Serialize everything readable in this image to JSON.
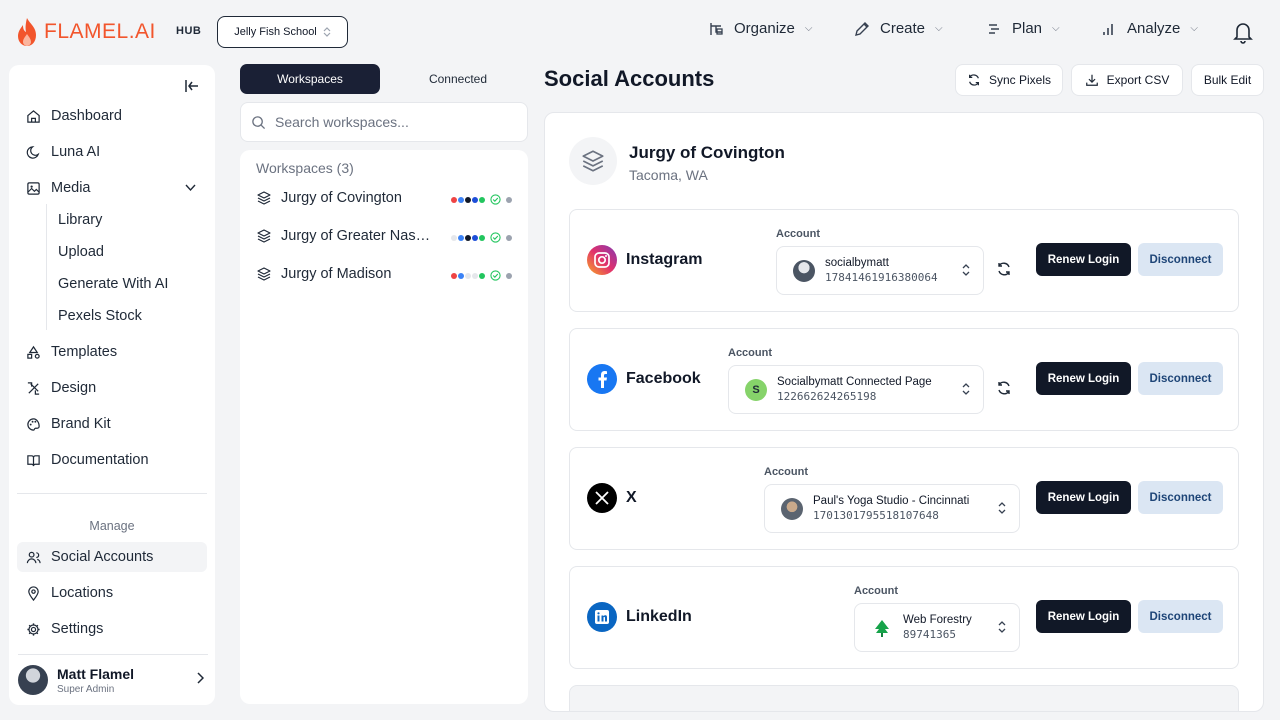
{
  "brand": {
    "logo_text": "FLAMEL.AI",
    "hub_label": "HUB",
    "accent": "#f2552c"
  },
  "header": {
    "school_selector": "Jelly Fish School",
    "nav": [
      {
        "label": "Organize",
        "icon": "organize-icon"
      },
      {
        "label": "Create",
        "icon": "pencil-icon"
      },
      {
        "label": "Plan",
        "icon": "list-icon"
      },
      {
        "label": "Analyze",
        "icon": "bar-chart-icon"
      }
    ]
  },
  "sidebar": {
    "items": [
      {
        "label": "Dashboard",
        "icon": "home-icon"
      },
      {
        "label": "Luna AI",
        "icon": "moon-icon"
      },
      {
        "label": "Media",
        "icon": "image-icon"
      },
      {
        "label": "Templates",
        "icon": "shapes-icon"
      },
      {
        "label": "Design",
        "icon": "design-icon"
      },
      {
        "label": "Brand Kit",
        "icon": "palette-icon"
      },
      {
        "label": "Documentation",
        "icon": "book-icon"
      }
    ],
    "media_sub": [
      "Library",
      "Upload",
      "Generate With AI",
      "Pexels Stock"
    ],
    "manage_label": "Manage",
    "manage_items": [
      {
        "label": "Social Accounts",
        "icon": "users-icon"
      },
      {
        "label": "Locations",
        "icon": "pin-icon"
      },
      {
        "label": "Settings",
        "icon": "gear-icon"
      }
    ],
    "user": {
      "name": "Matt Flamel",
      "role": "Super Admin"
    }
  },
  "workspaces": {
    "tabs": [
      "Workspaces",
      "Connected"
    ],
    "search_placeholder": "Search workspaces...",
    "heading": "Workspaces (3)",
    "items": [
      {
        "name": "Jurgy of Covington",
        "dots": [
          "#ef4444",
          "#3b82f6",
          "#111827",
          "#1d4ed8",
          "#22c55e"
        ]
      },
      {
        "name": "Jurgy of Greater Nashville",
        "dots": [
          "#e5e7eb",
          "#3b82f6",
          "#111827",
          "#1d4ed8",
          "#22c55e"
        ]
      },
      {
        "name": "Jurgy of Madison",
        "dots": [
          "#ef4444",
          "#3b82f6",
          "#e5e7eb",
          "#e5e7eb",
          "#22c55e"
        ]
      }
    ]
  },
  "page": {
    "title": "Social Accounts",
    "actions": [
      "Sync Pixels",
      "Export CSV",
      "Bulk Edit"
    ]
  },
  "location": {
    "name": "Jurgy of Covington",
    "city": "Tacoma, WA"
  },
  "accounts": [
    {
      "platform": "Instagram",
      "account_label": "Account",
      "account_name": "socialbymatt",
      "account_id": "17841461916380064",
      "renew_label": "Renew Login",
      "disconnect_label": "Disconnect"
    },
    {
      "platform": "Facebook",
      "account_label": "Account",
      "account_name": "Socialbymatt Connected Page",
      "account_id": "122662624265198",
      "avatar_letter": "S",
      "renew_label": "Renew Login",
      "disconnect_label": "Disconnect"
    },
    {
      "platform": "X",
      "account_label": "Account",
      "account_name": "Paul's Yoga Studio - Cincinnati",
      "account_id": "1701301795518107648",
      "renew_label": "Renew Login",
      "disconnect_label": "Disconnect"
    },
    {
      "platform": "LinkedIn",
      "account_label": "Account",
      "account_name": "Web Forestry",
      "account_id": "89741365",
      "renew_label": "Renew Login",
      "disconnect_label": "Disconnect"
    }
  ]
}
